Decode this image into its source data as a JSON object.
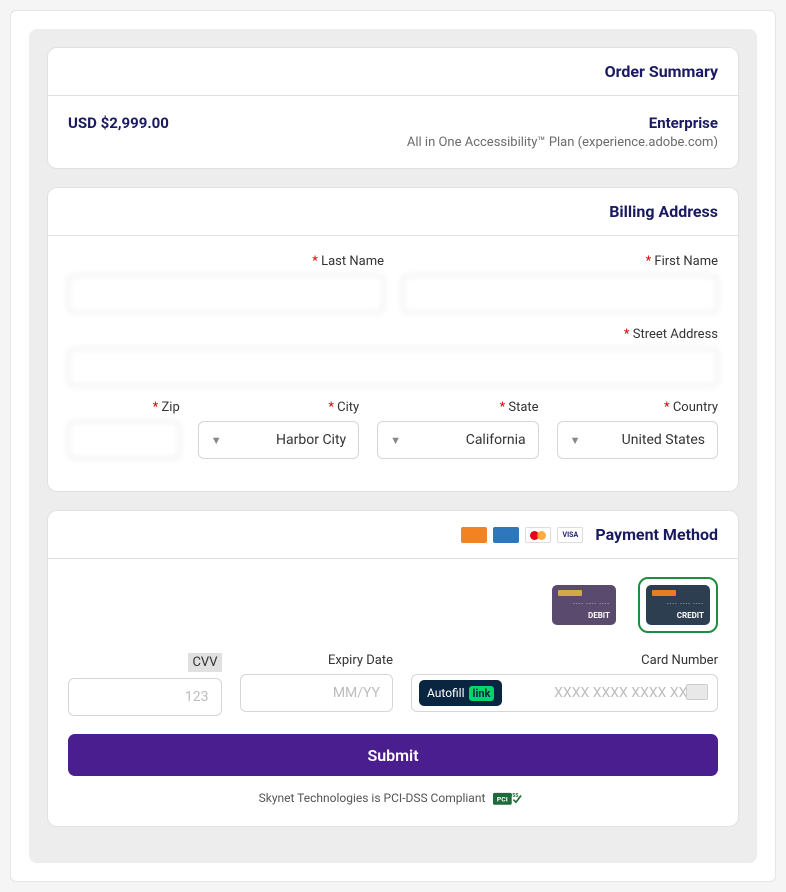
{
  "order": {
    "header": "Order Summary",
    "title": "Enterprise",
    "subtitle": "All in One Accessibility™ Plan (experience.adobe.com)",
    "price": "$2,999.00 USD"
  },
  "billing": {
    "header": "Billing Address",
    "first_name": {
      "label": "First Name",
      "value": ""
    },
    "last_name": {
      "label": "Last Name",
      "value": ""
    },
    "street": {
      "label": "Street Address",
      "value": ""
    },
    "country": {
      "label": "Country",
      "value": "United States"
    },
    "state": {
      "label": "State",
      "value": "California"
    },
    "city": {
      "label": "City",
      "value": "Harbor City"
    },
    "zip": {
      "label": "Zip",
      "value": ""
    }
  },
  "payment": {
    "header": "Payment Method",
    "credit_label": "CREDIT",
    "debit_label": "DEBIT",
    "card_number": {
      "label": "Card Number",
      "placeholder": "XXXX XXXX XXXX XXXX"
    },
    "expiry": {
      "label": "Expiry Date",
      "placeholder": "MM/YY"
    },
    "cvv": {
      "label": "CVV",
      "placeholder": "123"
    },
    "autofill_badge": "link",
    "autofill_text": "Autofill",
    "submit": "Submit"
  },
  "footer": {
    "text": "Skynet Technologies is PCI-DSS Compliant"
  },
  "required_mark": " *"
}
